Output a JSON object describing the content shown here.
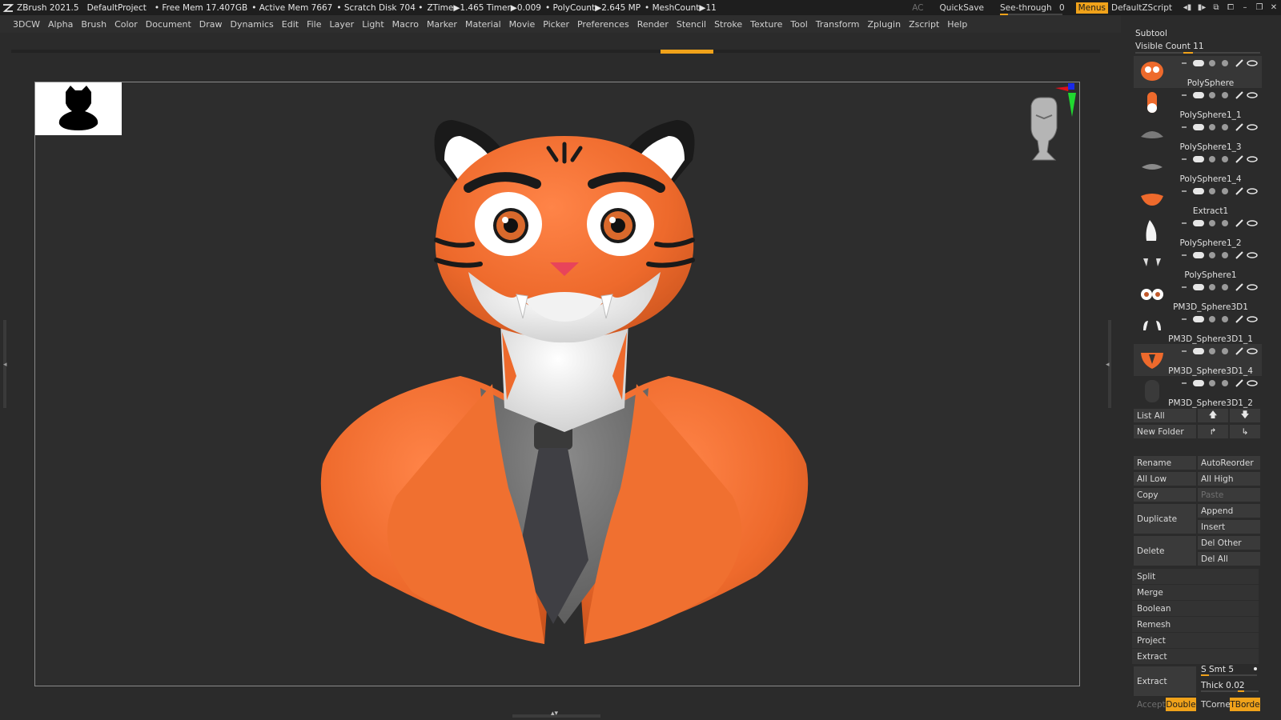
{
  "titlebar": {
    "app": "ZBrush 2021.5",
    "project": "DefaultProject",
    "free_mem": "• Free Mem 17.407GB",
    "active_mem": "• Active Mem 7667",
    "scratch": "• Scratch Disk 704 •",
    "ztime": "ZTime▶1.465 Timer▶0.009",
    "polycount": "• PolyCount▶2.645 MP",
    "meshcount": "• MeshCount▶11",
    "ac": "AC",
    "quicksave": "QuickSave",
    "see_through": "See-through",
    "see_through_value": "0",
    "menus": "Menus",
    "default_zscript": "DefaultZScript"
  },
  "menubar": [
    "3DCW",
    "Alpha",
    "Brush",
    "Color",
    "Document",
    "Draw",
    "Dynamics",
    "Edit",
    "File",
    "Layer",
    "Light",
    "Macro",
    "Marker",
    "Material",
    "Movie",
    "Picker",
    "Preferences",
    "Render",
    "Stencil",
    "Stroke",
    "Texture",
    "Tool",
    "Transform",
    "Zplugin",
    "Zscript",
    "Help"
  ],
  "subtool": {
    "header": "Subtool",
    "visible_count": "Visible Count 11",
    "items": [
      {
        "name": "PolySphere",
        "thumb": "tiger-head"
      },
      {
        "name": "PolySphere1_1",
        "thumb": "orange-capsule"
      },
      {
        "name": "PolySphere1_3",
        "thumb": "gray-shape"
      },
      {
        "name": "PolySphere1_4",
        "thumb": "gray-shape-small"
      },
      {
        "name": "Extract1",
        "thumb": "orange-collar"
      },
      {
        "name": "PolySphere1_2",
        "thumb": "white-ear"
      },
      {
        "name": "PolySphere1",
        "thumb": "eyelashes"
      },
      {
        "name": "PM3D_Sphere3D1",
        "thumb": "eyes"
      },
      {
        "name": "PM3D_Sphere3D1_1",
        "thumb": "fangs"
      },
      {
        "name": "PM3D_Sphere3D1_4",
        "thumb": "orange-jacket"
      },
      {
        "name": "PM3D_Sphere3D1_2",
        "thumb": "dark-tie"
      }
    ],
    "list_all": "List All",
    "new_folder": "New Folder",
    "rename": "Rename",
    "autoreorder": "AutoReorder",
    "all_low": "All Low",
    "all_high": "All High",
    "copy": "Copy",
    "paste": "Paste",
    "duplicate": "Duplicate",
    "append": "Append",
    "insert": "Insert",
    "delete": "Delete",
    "del_other": "Del Other",
    "del_all": "Del All",
    "split": "Split",
    "merge": "Merge",
    "boolean": "Boolean",
    "remesh": "Remesh",
    "project": "Project",
    "extract_section": "Extract",
    "extract_btn": "Extract",
    "s_smt": "S Smt 5",
    "thick": "Thick 0.02",
    "accept": "Accept",
    "double": "Double",
    "tcorne": "TCorne",
    "tborde": "TBorde"
  },
  "colors": {
    "accent": "#f0a21a",
    "tiger_orange": "#ee6a2c",
    "background": "#2b2b2b"
  }
}
